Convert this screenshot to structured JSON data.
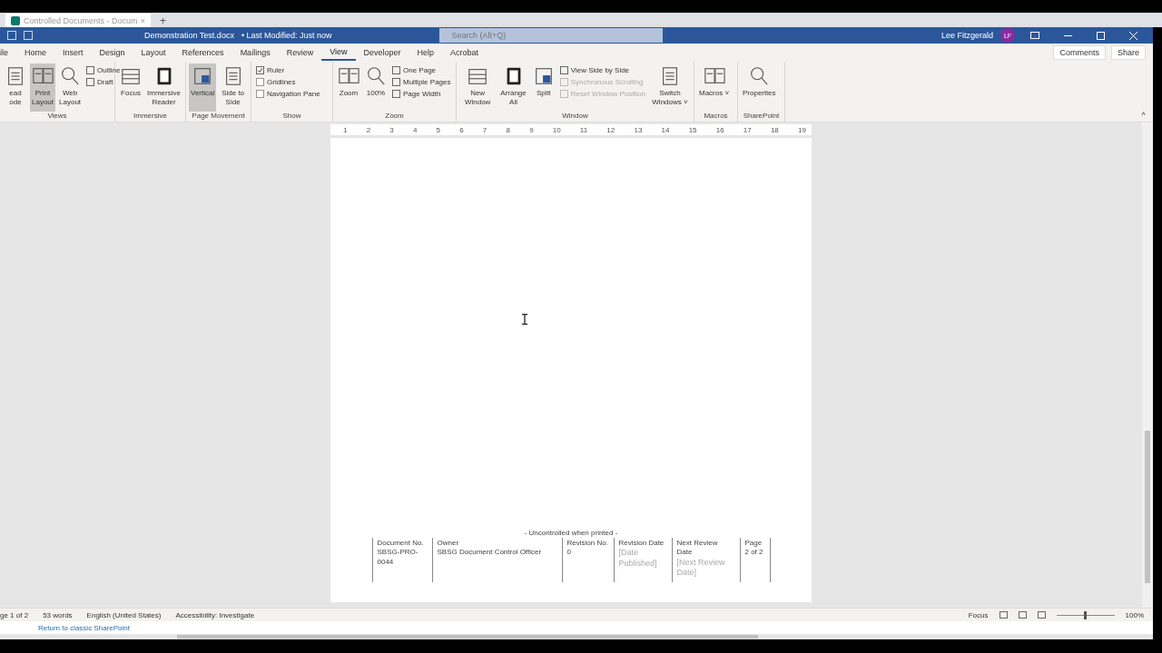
{
  "browser_tab": {
    "title": "Controlled Documents - Docum",
    "close": "×",
    "new_tab": "+"
  },
  "ribbon_collapse": "˄",
  "title_bar": {
    "document": "Demonstration Test.docx",
    "status": "• Last Modified: Just now",
    "search": {
      "placeholder": "Search (Alt+Q)"
    },
    "user": "Lee Fitzgerald",
    "avatar": "LF"
  },
  "menu_tabs": [
    {
      "label": "ile",
      "selected": false
    },
    {
      "label": "Home",
      "selected": false
    },
    {
      "label": "Insert",
      "selected": false
    },
    {
      "label": "Design",
      "selected": false
    },
    {
      "label": "Layout",
      "selected": false
    },
    {
      "label": "References",
      "selected": false
    },
    {
      "label": "Mailings",
      "selected": false
    },
    {
      "label": "Review",
      "selected": false
    },
    {
      "label": "View",
      "selected": true
    },
    {
      "label": "Developer",
      "selected": false
    },
    {
      "label": "Help",
      "selected": false
    },
    {
      "label": "Acrobat",
      "selected": false
    }
  ],
  "comments": "Comments",
  "share": "Share",
  "ribbon": {
    "groups": [
      {
        "name": "Views",
        "items": [
          {
            "kind": "large",
            "label": "ead ode",
            "selected": false
          },
          {
            "kind": "large",
            "label": "Print Layout",
            "selected": true
          },
          {
            "kind": "large",
            "label": "Web Layout",
            "selected": false
          },
          {
            "kind": "column",
            "items": [
              {
                "kind": "small",
                "label": "Outline",
                "disabled": false
              },
              {
                "kind": "small",
                "label": "Draft",
                "disabled": false
              }
            ]
          }
        ]
      },
      {
        "name": "Immersive",
        "items": [
          {
            "kind": "large",
            "label": "Focus",
            "selected": false
          },
          {
            "kind": "large",
            "label": "Immersive Reader",
            "selected": false
          }
        ]
      },
      {
        "name": "Page Movement",
        "items": [
          {
            "kind": "large",
            "label": "Vertical",
            "selected": true
          },
          {
            "kind": "large",
            "label": "Side to Side",
            "selected": false
          }
        ]
      },
      {
        "name": "Show",
        "items": [
          {
            "kind": "column",
            "items": [
              {
                "kind": "check",
                "label": "Ruler",
                "checked": true
              },
              {
                "kind": "check",
                "label": "Gridlines",
                "checked": false
              },
              {
                "kind": "check",
                "label": "Navigation Pane",
                "checked": false
              }
            ]
          }
        ]
      },
      {
        "name": "Zoom",
        "items": [
          {
            "kind": "large",
            "label": "Zoom",
            "selected": false
          },
          {
            "kind": "large",
            "label": "100%",
            "selected": false
          },
          {
            "kind": "column",
            "items": [
              {
                "kind": "small",
                "label": "One Page",
                "disabled": false
              },
              {
                "kind": "small",
                "label": "Multiple Pages",
                "disabled": false
              },
              {
                "kind": "small",
                "label": "Page Width",
                "disabled": false
              }
            ]
          }
        ]
      },
      {
        "name": "Window",
        "items": [
          {
            "kind": "large",
            "label": "New Window",
            "selected": false
          },
          {
            "kind": "large",
            "label": "Arrange All",
            "selected": false
          },
          {
            "kind": "large",
            "label": "Split",
            "selected": false
          },
          {
            "kind": "column",
            "items": [
              {
                "kind": "small",
                "label": "View Side by Side",
                "disabled": false
              },
              {
                "kind": "small",
                "label": "Synchronous Scrolling",
                "disabled": true
              },
              {
                "kind": "small",
                "label": "Reset Window Position",
                "disabled": true
              }
            ]
          },
          {
            "kind": "large",
            "label": "Switch Windows ˅",
            "selected": false
          }
        ]
      },
      {
        "name": "Macros",
        "items": [
          {
            "kind": "large",
            "label": "Macros ˅",
            "selected": false
          }
        ]
      },
      {
        "name": "SharePoint",
        "items": [
          {
            "kind": "large",
            "label": "Properties",
            "selected": false
          }
        ]
      }
    ]
  },
  "ruler": {
    "marks": [
      "1",
      "2",
      "3",
      "4",
      "5",
      "6",
      "7",
      "8",
      "9",
      "10",
      "11",
      "12",
      "13",
      "14",
      "15",
      "16",
      "17",
      "18",
      "19"
    ]
  },
  "footer": {
    "notice": "- Uncontrolled when printed -",
    "columns": [
      {
        "heading": "Document No.",
        "value": "SBSG-PRO-0044",
        "placeholder": false
      },
      {
        "heading": "Owner",
        "value": "SBSG Document Control Officer",
        "placeholder": false
      },
      {
        "heading": "Revision No.",
        "value": "0",
        "placeholder": false
      },
      {
        "heading": "Revision Date",
        "value": "[Date Published]",
        "placeholder": true
      },
      {
        "heading": "Next Review Date",
        "value": "[Next Review Date]",
        "placeholder": true
      },
      {
        "heading": "Page",
        "value": "2 of 2",
        "placeholder": false
      }
    ]
  },
  "status_bar": {
    "items": [
      "ge 1 of 2",
      "53 words",
      "English (United States)",
      "Accessibility: Investigate"
    ],
    "focus": "Focus",
    "zoom": {
      "level": 0.48,
      "reading": "100%"
    }
  },
  "link": "Return to classic SharePoint"
}
